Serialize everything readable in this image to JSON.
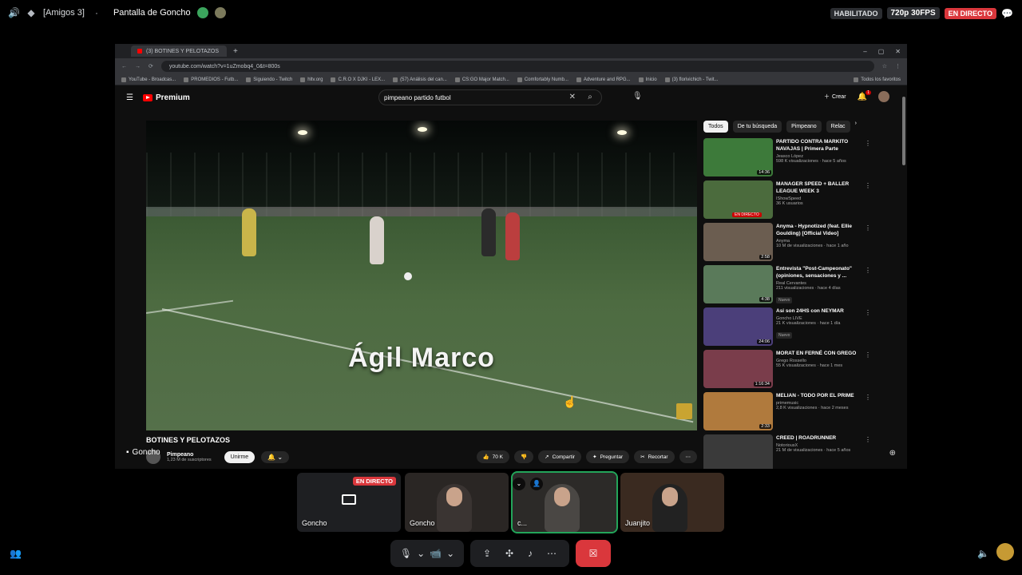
{
  "discord": {
    "server_label": "[Amigos 3]",
    "stream_title": "Pantalla de Goncho",
    "status_enabled": "HABILITADO",
    "quality": "720p 30FPS",
    "live_badge": "EN DIRECTO"
  },
  "browser": {
    "tab_title": "(3) BOTINES Y PELOTAZOS",
    "url": "youtube.com/watch?v=1uZmobq4_0&t=800s",
    "bookmarks": [
      "YouTube - Broadcas...",
      "PROMEDIOS - Futb...",
      "Siguiendo - Twitch",
      "hltv.org",
      "C.R.O X DJKI - LEX...",
      "(57) Análisis del can...",
      "CS:GO Major Match...",
      "Comfortably Numb...",
      "Adventure and RPG...",
      "Inicio",
      "(3) florivichich - Twit..."
    ],
    "all_favorites": "Todos los favoritos"
  },
  "youtube": {
    "logo": "Premium",
    "search_value": "pimpeano partido futbol",
    "create_label": "Crear",
    "notif_count": "1",
    "video_overlay_text": "Ágil Marco",
    "video_title": "BOTINES Y PELOTAZOS",
    "channel_name": "Pimpeano",
    "subscribers": "1,23 M de suscriptores",
    "unsubscribe_label": "Unirme",
    "likes": "70 K",
    "share_label": "Compartir",
    "ask_label": "Preguntar",
    "clip_label": "Recortar",
    "chips": [
      "Todos",
      "De tu búsqueda",
      "Pimpeano",
      "Relac"
    ],
    "recommendations": [
      {
        "title": "PARTIDO CONTRA MARKITO NAVAJAS | Primera Parte",
        "channel": "Jeasco López",
        "meta": "598 K visualizaciones · hace 5 años",
        "duration": "14:36",
        "live": "",
        "tag": "",
        "color": "#3d7a3a"
      },
      {
        "title": "MANAGER SPEED + BALLER LEAGUE WEEK 3",
        "channel": "IShowSpeed",
        "meta": "36 K usuarios",
        "duration": "",
        "live": "EN DIRECTO",
        "tag": "",
        "color": "#4b6b3d"
      },
      {
        "title": "Anyma - Hypnotized (feat. Ellie Goulding) [Official Video]",
        "channel": "Anyma",
        "meta": "10 M de visualizaciones · hace 1 año",
        "duration": "2:58",
        "live": "",
        "tag": "",
        "color": "#6b5d50"
      },
      {
        "title": "Entrevista \"Post-Campeonato\" (opiniones, sensaciones y ...",
        "channel": "Real Cervantes",
        "meta": "211 visualizaciones · hace 4 días",
        "duration": "4:38",
        "live": "",
        "tag": "Nuevo",
        "color": "#5a7a5a"
      },
      {
        "title": "Asi son 24HS con NEYMAR",
        "channel": "Goncho LIVE",
        "meta": "21 K visualizaciones · hace 1 día",
        "duration": "24:06",
        "live": "",
        "tag": "Nuevo",
        "color": "#4b3f7a"
      },
      {
        "title": "MORAT EN FERNÉ CON GREGO",
        "channel": "Grego Rossello",
        "meta": "55 K visualizaciones · hace 1 mes",
        "duration": "1:16:34",
        "live": "",
        "tag": "",
        "color": "#7a3d4b"
      },
      {
        "title": "MELIAN - TODO POR EL PRIME",
        "channel": "primemusic",
        "meta": "2,8 K visualizaciones · hace 2 meses",
        "duration": "2:33",
        "live": "",
        "tag": "",
        "color": "#b07a3d"
      },
      {
        "title": "CREED | ROADRUNNER",
        "channel": "NotoriousX",
        "meta": "21 M de visualizaciones · hace 5 años",
        "duration": "",
        "live": "",
        "tag": "",
        "color": "#3a3a3a"
      }
    ]
  },
  "call": {
    "presenter_label": "Goncho",
    "tiles": [
      {
        "label": "Goncho",
        "live": "EN DIRECTO",
        "type": "screen"
      },
      {
        "label": "Goncho",
        "live": "",
        "type": "person"
      },
      {
        "label": "c...",
        "live": "",
        "type": "person-active"
      },
      {
        "label": "Juanjito",
        "live": "",
        "type": "person"
      }
    ]
  }
}
